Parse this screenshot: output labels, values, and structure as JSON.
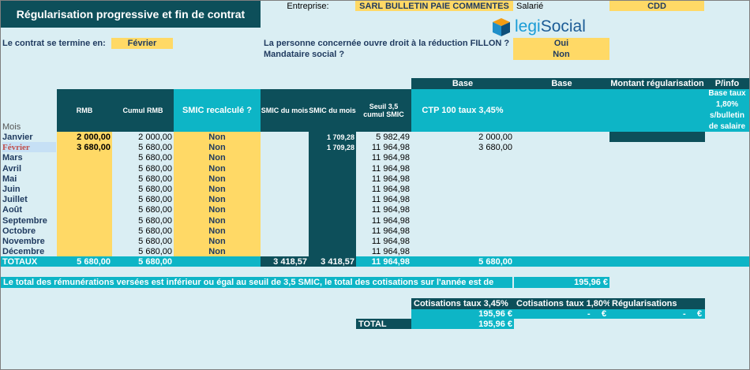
{
  "title": "Régularisation progressive et fin de contrat",
  "company": {
    "label": "Entreprise:",
    "value": "SARL BULLETIN PAIE COMMENTES"
  },
  "employee": {
    "label": "Salarié",
    "value": "CDD"
  },
  "logo": {
    "text_left": "legi",
    "text_right": "Social"
  },
  "contract_end": {
    "label": "Le contrat se termine en:",
    "value": "Février"
  },
  "fillon": {
    "label": "La personne concernée ouvre droit à la réduction FILLON ?",
    "value": "Oui"
  },
  "mandataire": {
    "label": "Mandataire social ?",
    "value": "Non"
  },
  "headers": {
    "base1": "Base",
    "base2": "Base",
    "montant": "Montant régularisation",
    "pinfo": "P/info",
    "rmb": "RMB",
    "cumul_rmb": "Cumul RMB",
    "smic_recalc": "SMIC recalculé ?",
    "smic_mois1": "SMIC du mois",
    "smic_mois2": "SMIC du mois",
    "seuil": "Seuil 3,5 cumul SMIC",
    "ctp": "CTP 100 taux 3,45%",
    "base_taux": "Base taux 1,80% s/bulletin de salaire",
    "mois": "Mois"
  },
  "rows": [
    {
      "month": "Janvier",
      "rmb": "2 000,00",
      "cumul": "2 000,00",
      "smic": "Non",
      "smic_mois": "1 709,28",
      "seuil": "5 982,49",
      "ctp": "2 000,00"
    },
    {
      "month": "Février",
      "rmb": "3 680,00",
      "cumul": "5 680,00",
      "smic": "Non",
      "smic_mois": "1 709,28",
      "seuil": "11 964,98",
      "ctp": "3 680,00"
    },
    {
      "month": "Mars",
      "rmb": "",
      "cumul": "5 680,00",
      "smic": "Non",
      "smic_mois": "",
      "seuil": "11 964,98",
      "ctp": ""
    },
    {
      "month": "Avril",
      "rmb": "",
      "cumul": "5 680,00",
      "smic": "Non",
      "smic_mois": "",
      "seuil": "11 964,98",
      "ctp": ""
    },
    {
      "month": "Mai",
      "rmb": "",
      "cumul": "5 680,00",
      "smic": "Non",
      "smic_mois": "",
      "seuil": "11 964,98",
      "ctp": ""
    },
    {
      "month": "Juin",
      "rmb": "",
      "cumul": "5 680,00",
      "smic": "Non",
      "smic_mois": "",
      "seuil": "11 964,98",
      "ctp": ""
    },
    {
      "month": "Juillet",
      "rmb": "",
      "cumul": "5 680,00",
      "smic": "Non",
      "smic_mois": "",
      "seuil": "11 964,98",
      "ctp": ""
    },
    {
      "month": "Août",
      "rmb": "",
      "cumul": "5 680,00",
      "smic": "Non",
      "smic_mois": "",
      "seuil": "11 964,98",
      "ctp": ""
    },
    {
      "month": "Septembre",
      "rmb": "",
      "cumul": "5 680,00",
      "smic": "Non",
      "smic_mois": "",
      "seuil": "11 964,98",
      "ctp": ""
    },
    {
      "month": "Octobre",
      "rmb": "",
      "cumul": "5 680,00",
      "smic": "Non",
      "smic_mois": "",
      "seuil": "11 964,98",
      "ctp": ""
    },
    {
      "month": "Novembre",
      "rmb": "",
      "cumul": "5 680,00",
      "smic": "Non",
      "smic_mois": "",
      "seuil": "11 964,98",
      "ctp": ""
    },
    {
      "month": "Décembre",
      "rmb": "",
      "cumul": "5 680,00",
      "smic": "Non",
      "smic_mois": "",
      "seuil": "11 964,98",
      "ctp": ""
    }
  ],
  "totals": {
    "label": "TOTAUX",
    "rmb": "5 680,00",
    "cumul": "5 680,00",
    "smic1": "3 418,57",
    "smic2": "3 418,57",
    "seuil": "11 964,98",
    "ctp": "5 680,00"
  },
  "summary": {
    "text": "Le total des rémunérations versées est inférieur ou égal au seuil de 3,5 SMIC, le total des cotisations sur l'année est de",
    "value": "195,96 €"
  },
  "cotisations": {
    "h1": "Cotisations taux 3,45%",
    "h2": "Cotisations taux 1,80%",
    "h3": "Régularisations",
    "v1": "195,96 €",
    "v2": "-",
    "v2_unit": "€",
    "v3": "-",
    "v3_unit": "€",
    "total_label": "TOTAL",
    "total_value": "195,96 €"
  },
  "colors": {
    "dark_teal": "#0d4f5a",
    "cyan": "#0db5c6",
    "yellow": "#ffd966",
    "light_blue": "#daeef3"
  }
}
